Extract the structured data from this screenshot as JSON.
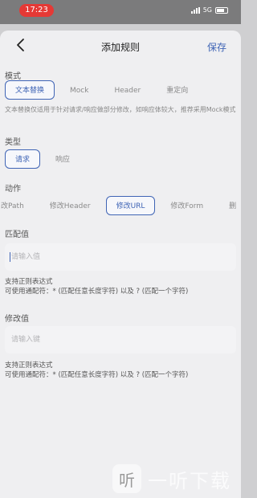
{
  "status": {
    "time": "17:23",
    "network": "5G",
    "time_color": "#e53935"
  },
  "nav": {
    "title": "添加规则",
    "save_label": "保存",
    "accent": "#3f64b5"
  },
  "mode": {
    "label": "模式",
    "options": [
      "文本替换",
      "Mock",
      "Header",
      "重定向"
    ],
    "selected": "文本替换",
    "description": "文本替换仅适用于针对请求/响应做部分修改，如响应体较大，推荐采用Mock模式"
  },
  "type": {
    "label": "类型",
    "options": [
      "请求",
      "响应"
    ],
    "selected": "请求"
  },
  "action": {
    "label": "动作",
    "options": [
      "改Path",
      "修改Header",
      "修改URL",
      "修改Form",
      "删"
    ],
    "selected": "修改URL"
  },
  "match": {
    "label": "匹配值",
    "placeholder": "请输入值",
    "help_line1": "支持正则表达式",
    "help_line2": "可使用通配符：* (匹配任意长度字符) 以及 ? (匹配一个字符)"
  },
  "replace": {
    "label": "修改值",
    "placeholder": "请输入键",
    "help_line1": "支持正则表达式",
    "help_line2": "可使用通配符：* (匹配任意长度字符) 以及 ? (匹配一个字符)"
  },
  "watermark": {
    "logo_glyph": "听",
    "text": "一听下载"
  }
}
